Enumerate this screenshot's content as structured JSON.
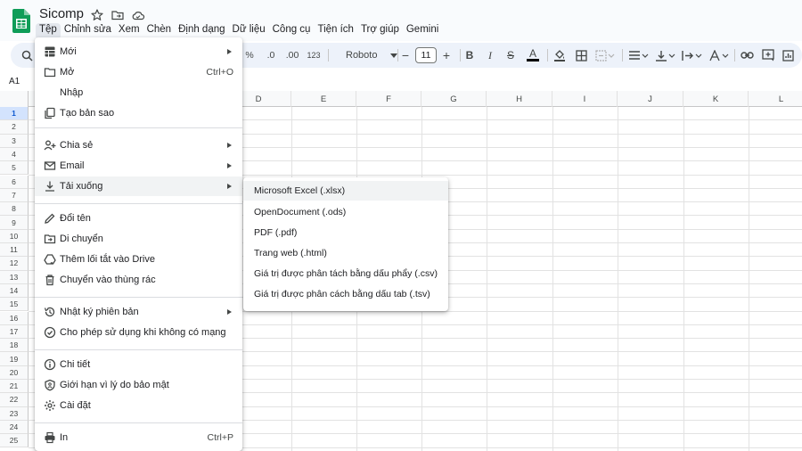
{
  "app": {
    "title": "Sicomp",
    "accent": "#0f9d58"
  },
  "menubar": {
    "items": [
      "Tệp",
      "Chỉnh sửa",
      "Xem",
      "Chèn",
      "Định dạng",
      "Dữ liệu",
      "Công cụ",
      "Tiện ích",
      "Trợ giúp",
      "Gemini"
    ],
    "active": "Tệp"
  },
  "toolbar": {
    "percent": "%",
    "dec_decrease": ".0",
    "dec_increase": ".00",
    "number_format": "123",
    "font": "Roboto",
    "font_size": "11",
    "minus": "−",
    "plus": "+",
    "bold": "B",
    "italic": "I",
    "strike": "S",
    "text_color": "A",
    "text_color_value": "#000000"
  },
  "namebox": "A1",
  "grid": {
    "columns": [
      "D",
      "E",
      "F",
      "G",
      "H",
      "I",
      "J",
      "K",
      "L"
    ],
    "rows": [
      "1",
      "2",
      "3",
      "4",
      "5",
      "6",
      "7",
      "8",
      "9",
      "10",
      "11",
      "12",
      "13",
      "14",
      "15",
      "16",
      "17",
      "18",
      "19",
      "20",
      "21",
      "22",
      "23",
      "24",
      "25"
    ],
    "selected_row": "1"
  },
  "file_menu": {
    "items": [
      {
        "label": "Mới",
        "icon": "new-sheet-icon",
        "submenu": true
      },
      {
        "label": "Mở",
        "icon": "folder-open-icon",
        "shortcut": "Ctrl+O"
      },
      {
        "label": "Nhập",
        "icon": "import-icon"
      },
      {
        "label": "Tạo bản sao",
        "icon": "copy-icon"
      },
      {
        "label": "Chia sẻ",
        "icon": "share-person-icon",
        "submenu": true
      },
      {
        "label": "Email",
        "icon": "mail-icon",
        "submenu": true
      },
      {
        "label": "Tải xuống",
        "icon": "download-icon",
        "submenu": true,
        "highlighted": true
      },
      {
        "label": "Đổi tên",
        "icon": "pencil-icon"
      },
      {
        "label": "Di chuyển",
        "icon": "move-folder-icon"
      },
      {
        "label": "Thêm lối tắt vào Drive",
        "icon": "drive-shortcut-icon"
      },
      {
        "label": "Chuyển vào thùng rác",
        "icon": "trash-icon"
      },
      {
        "label": "Nhật ký phiên bản",
        "icon": "history-icon",
        "submenu": true
      },
      {
        "label": "Cho phép sử dụng khi không có mạng",
        "icon": "offline-icon"
      },
      {
        "label": "Chi tiết",
        "icon": "info-icon"
      },
      {
        "label": "Giới hạn vì lý do bảo mật",
        "icon": "shield-icon"
      },
      {
        "label": "Cài đặt",
        "icon": "gear-icon"
      },
      {
        "label": "In",
        "icon": "printer-icon",
        "shortcut": "Ctrl+P"
      }
    ]
  },
  "download_submenu": {
    "items": [
      "Microsoft Excel (.xlsx)",
      "OpenDocument (.ods)",
      "PDF (.pdf)",
      "Trang web (.html)",
      "Giá trị được phân tách bằng dấu phẩy (.csv)",
      "Giá trị được phân cách bằng dấu tab (.tsv)"
    ],
    "highlighted": "Microsoft Excel (.xlsx)"
  }
}
